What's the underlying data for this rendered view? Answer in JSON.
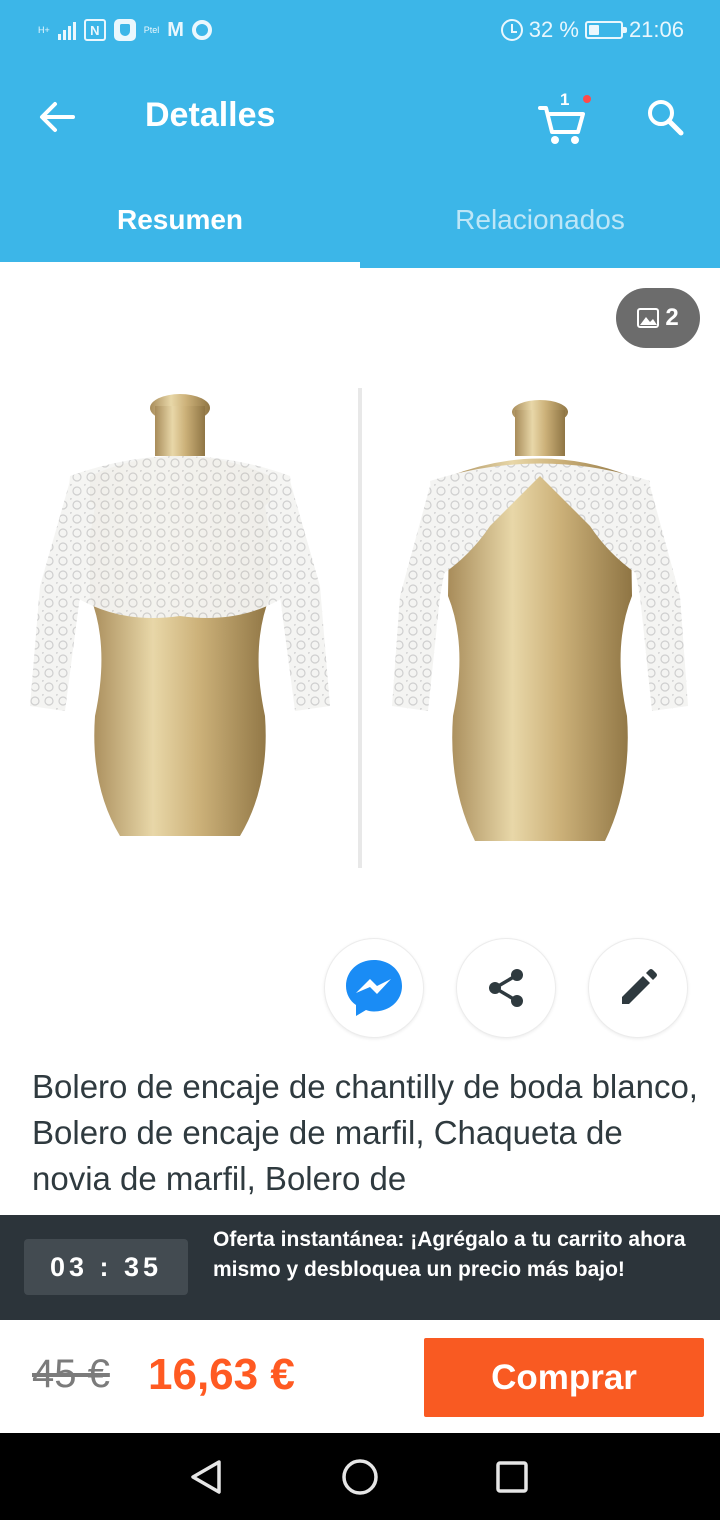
{
  "status_bar": {
    "battery": "32 %",
    "time": "21:06",
    "network_label": "H+",
    "nfc": "N",
    "tiny_label": "Ptel"
  },
  "app_bar": {
    "title": "Detalles",
    "cart_count": "1"
  },
  "tabs": [
    {
      "label": "Resumen",
      "active": true
    },
    {
      "label": "Relacionados",
      "active": false
    }
  ],
  "gallery": {
    "image_count": "2",
    "image_alt": "mannequin-front-and-back-lace-bolero"
  },
  "actions": [
    {
      "icon": "messenger-icon"
    },
    {
      "icon": "share-icon"
    },
    {
      "icon": "edit-icon"
    }
  ],
  "product": {
    "title": "Bolero de encaje de chantilly de boda blanco, Bolero de encaje de marfil, Chaqueta de novia de marfil, Bolero de"
  },
  "offer": {
    "countdown": "03 : 35",
    "text": "Oferta instantánea: ¡Agrégalo a tu carrito ahora mismo y desbloquea un precio más bajo!"
  },
  "pricing": {
    "old_price": "45 €",
    "new_price": "16,63 €",
    "buy_label": "Comprar"
  },
  "colors": {
    "primary": "#3cb6e8",
    "accent": "#f95a22",
    "banner": "#2c343a"
  }
}
